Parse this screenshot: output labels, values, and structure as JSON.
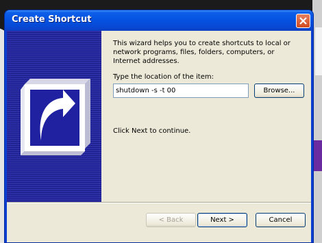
{
  "window": {
    "title": "Create Shortcut"
  },
  "wizard": {
    "description": "This wizard helps you to create shortcuts to local or network programs, files, folders, computers, or Internet addresses.",
    "location_label": "Type the location of the item:",
    "location_value": "shutdown -s -t 00",
    "browse_label": "Browse...",
    "continue_hint": "Click Next to continue."
  },
  "buttons": {
    "back_label": "< Back",
    "back_enabled": false,
    "next_label": "Next >",
    "cancel_label": "Cancel"
  },
  "icons": {
    "close": "close-icon",
    "shortcut": "shortcut-arrow-icon"
  },
  "colors": {
    "titlebar": "#0552e0",
    "side_panel": "#2d2fa6",
    "client": "#ece9d8",
    "close_button": "#d14a1e"
  }
}
